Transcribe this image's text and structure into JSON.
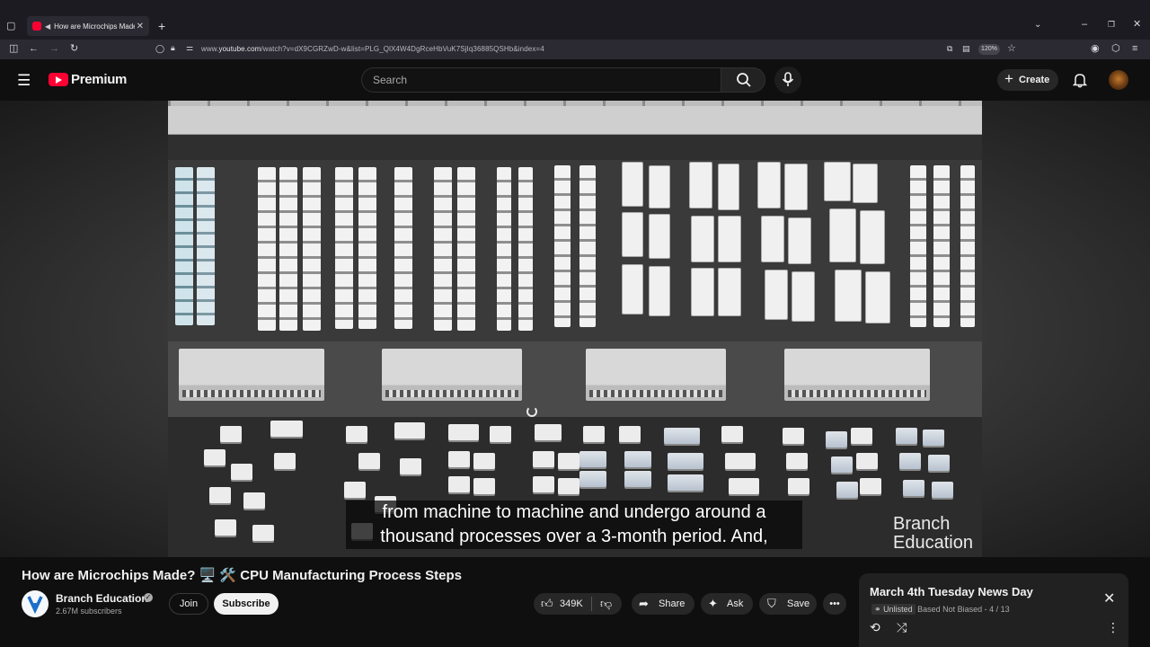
{
  "browser": {
    "tab_title": "How are Microchips Made? 🖥️",
    "url_prefix": "www.",
    "url_domain": "youtube.com",
    "url_path": "/watch?v=dX9CGRZwD-w&list=PLG_QlX4W4DgRceHbVuK7SjIq36885QSHb&index=4",
    "zoom": "120%"
  },
  "header": {
    "logo_text": "Premium",
    "search_placeholder": "Search",
    "create_label": "Create"
  },
  "video": {
    "subtitle_line1": "from machine to machine and undergo around a",
    "subtitle_line2": "thousand processes over a 3-month period. And,",
    "watermark_line1": "Branch",
    "watermark_line2": "Education"
  },
  "details": {
    "title": "How are Microchips Made? 🖥️ 🛠️ CPU Manufacturing Process Steps",
    "channel_name": "Branch Education",
    "channel_subs": "2.67M subscribers",
    "join_label": "Join",
    "subscribe_label": "Subscribe",
    "likes": "349K",
    "share_label": "Share",
    "ask_label": "Ask",
    "save_label": "Save"
  },
  "playlist": {
    "title": "March 4th Tuesday News Day",
    "unlisted": "Unlisted",
    "owner": "Based Not Biased",
    "position": "4 / 13"
  }
}
